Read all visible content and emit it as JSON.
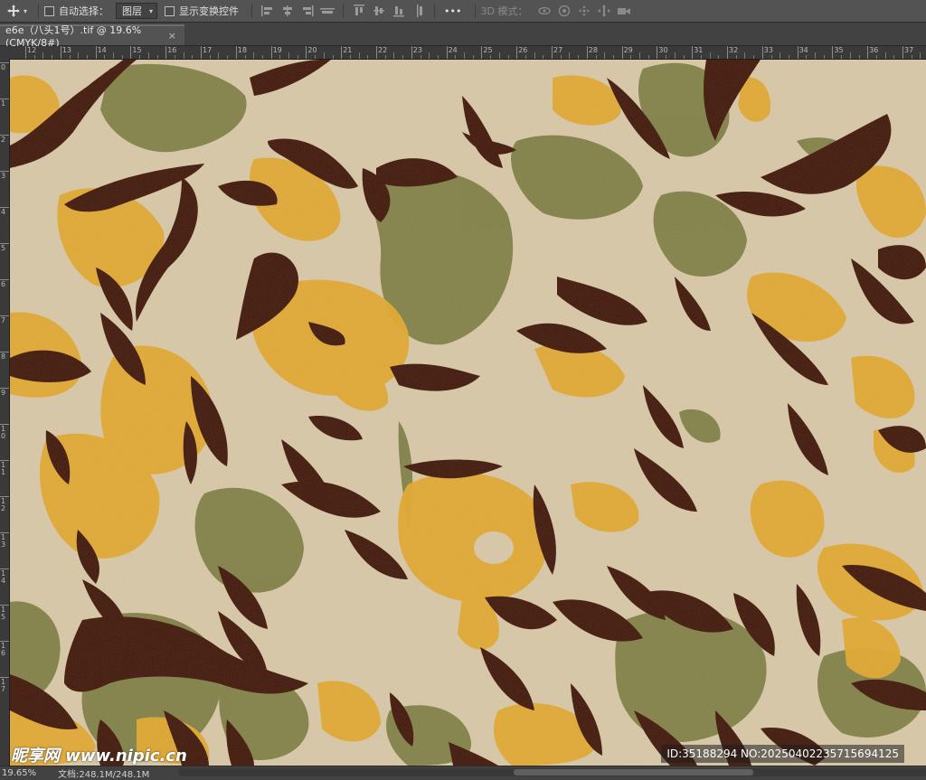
{
  "options_bar": {
    "move_tool_icon": "move-arrows-icon",
    "auto_select_label": "自动选择：",
    "auto_select_checked": false,
    "auto_select_target": "图层",
    "show_transform_label": "显示变换控件",
    "show_transform_checked": false,
    "more_label": "•••",
    "mode_3d_label": "3D 模式："
  },
  "document_tab": {
    "title": "e6e（八头1号）.tif @ 19.6%(CMYK/8#)",
    "close_label": "×"
  },
  "ruler_h_ticks": [
    "12",
    "13",
    "14",
    "15",
    "16",
    "17",
    "18",
    "19",
    "20",
    "21",
    "22",
    "23",
    "24",
    "25",
    "26",
    "27",
    "28",
    "29",
    "30",
    "31",
    "32",
    "33",
    "34",
    "35",
    "36",
    "37"
  ],
  "ruler_v_ticks": [
    "0",
    "1",
    "2",
    "3",
    "4",
    "5",
    "6",
    "7",
    "8",
    "9",
    "10",
    "11",
    "12",
    "13",
    "14",
    "15",
    "16",
    "17"
  ],
  "colors": {
    "cream": "#d9c8a6",
    "mustard": "#e3a82b",
    "olive": "#7d7d40",
    "dark_brown": "#3f1506"
  },
  "status_bar": {
    "zoom": "19.65%",
    "doc_info": "文档:248.1M/248.1M",
    "arrow": "›"
  },
  "watermarks": {
    "logo": "昵享网 www.nipic.cn",
    "id": "ID:35188294 NO:20250402235715694125"
  }
}
